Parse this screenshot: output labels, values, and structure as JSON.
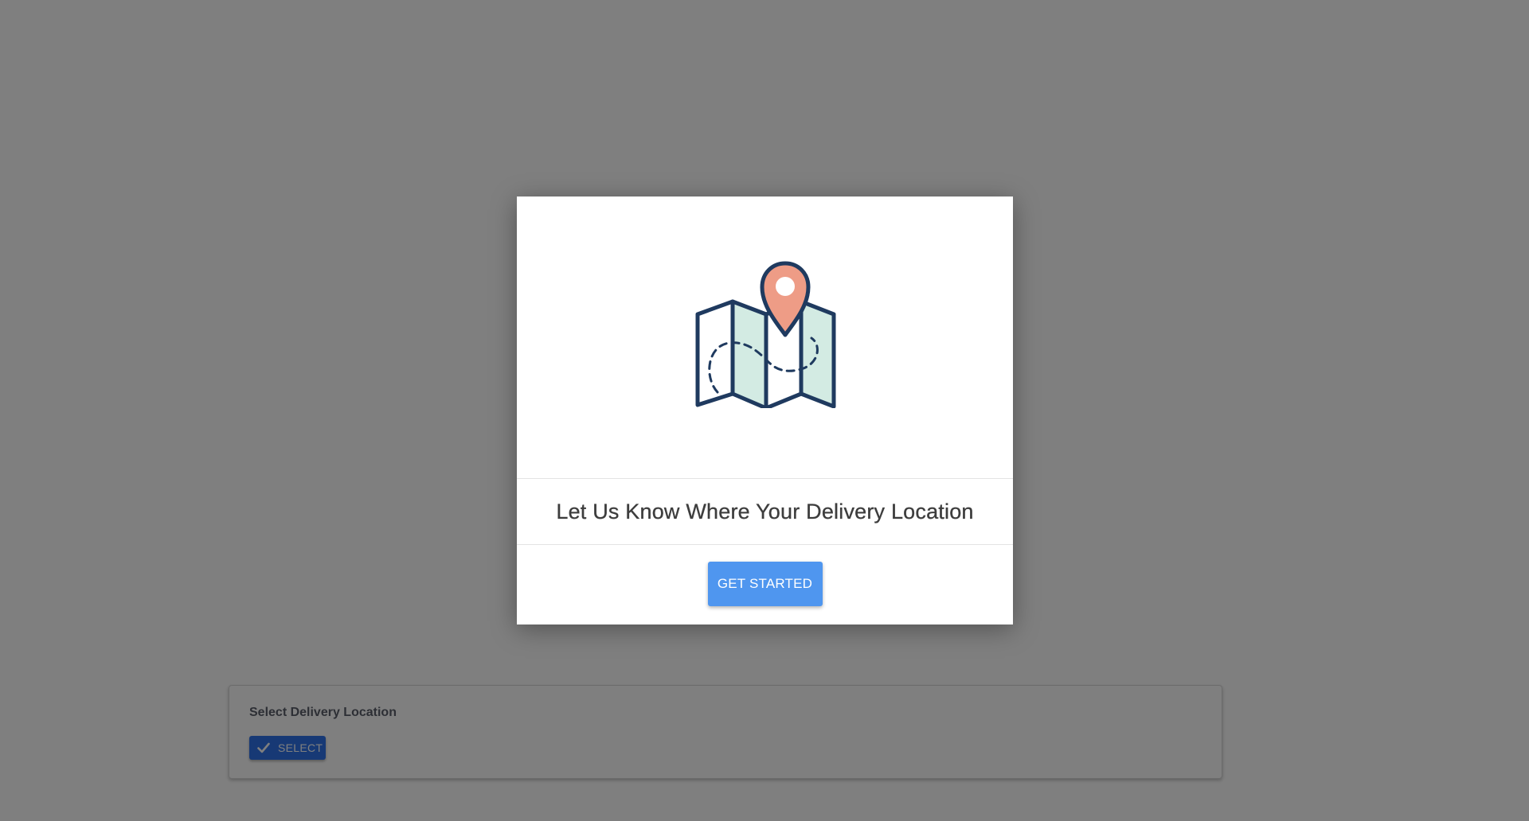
{
  "modal": {
    "illustration_icon": "map-with-location-pin-icon",
    "title": "Let Us Know Where Your Delivery Location",
    "cta_label": "GET STARTED"
  },
  "location_card": {
    "label": "Select Delivery Location",
    "select_button_label": "SELECT",
    "select_button_icon": "checkmark-icon"
  },
  "colors": {
    "overlay": "#808080",
    "primary_button": "#4f96ef",
    "select_button": "#2f73ea",
    "map_outline": "#1f3a5f",
    "map_fill_tint": "#d3ebe3",
    "pin_fill": "#ee9c86",
    "title_text": "#3d3d3d"
  }
}
